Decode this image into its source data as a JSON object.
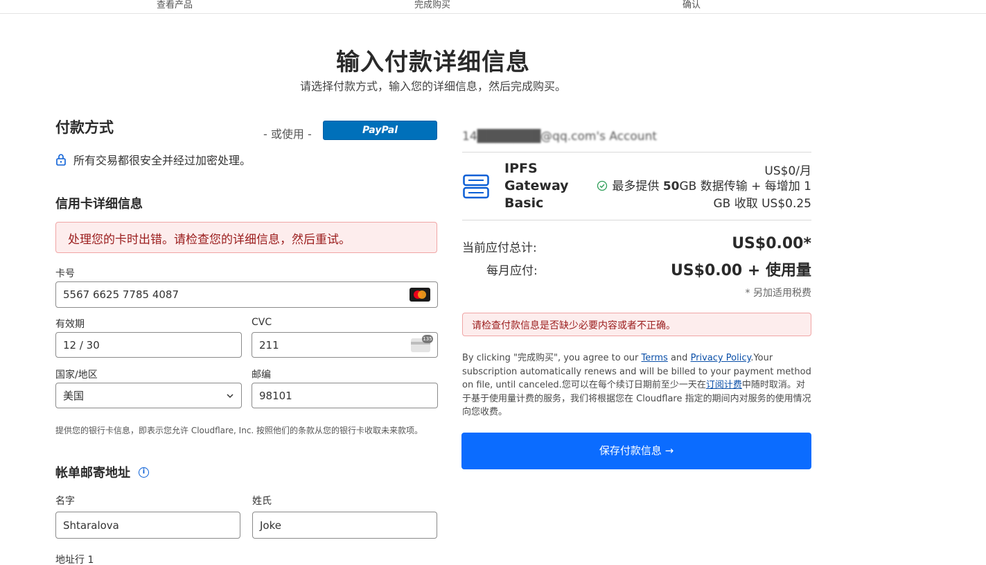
{
  "steps": [
    "查看产品",
    "完成购买",
    "确认"
  ],
  "page": {
    "title": "输入付款详细信息",
    "subtitle": "请选择付款方式，输入您的详细信息，然后完成购买。"
  },
  "payment": {
    "title": "付款方式",
    "or_use": "- 或使用 -",
    "paypal": "PayPal",
    "secure_note": "所有交易都很安全并经过加密处理。"
  },
  "card": {
    "title": "信用卡详细信息",
    "error": "处理您的卡时出错。请检查您的详细信息，然后重试。",
    "number_label": "卡号",
    "number_value": "5567 6625 7785 4087",
    "expiry_label": "有效期",
    "expiry_value": "12 / 30",
    "cvc_label": "CVC",
    "cvc_value": "211",
    "cvc_badge": "135",
    "country_label": "国家/地区",
    "country_value": "美国",
    "zip_label": "邮编",
    "zip_value": "98101",
    "consent": "提供您的银行卡信息，即表示您允许 Cloudflare, Inc. 按照他们的条款从您的银行卡收取未来款项。"
  },
  "billing": {
    "title": "帐单邮寄地址",
    "info_icon": "i",
    "first_name_label": "名字",
    "first_name_value": "Shtaralova",
    "last_name_label": "姓氏",
    "last_name_value": "Joke",
    "address1_label": "地址行 1"
  },
  "summary": {
    "email": "14███████@qq.com's Account",
    "product": {
      "name": "IPFS Gateway Basic",
      "price": "US$0/月",
      "feature_pre": "最多提供 ",
      "feature_bold": "50",
      "feature_post": "GB 数据传输 + 每增加 1 GB 收取 US$0.25"
    },
    "current_total_label": "当前应付总计:",
    "current_total_value": "US$0.00*",
    "monthly_label": "每月应付:",
    "monthly_value": "US$0.00 + 使用量",
    "tax_note": "* 另加适用税费",
    "warning": "请检查付款信息是否缺少必要内容或者不正确。",
    "legal": {
      "part1": "By clicking \"完成购买\", you agree to our ",
      "terms": "Terms",
      "and": " and ",
      "privacy": "Privacy Policy",
      "part2": ".Your subscription automatically renews and will be billed to your payment method on file, until canceled.您可以在每个续订日期前至少一天在",
      "billing_link": "订阅计费",
      "part3": "中随时取消。对于基于使用量计费的服务，我们将根据您在 Cloudflare 指定的期间内对服务的使用情况向您收费。"
    },
    "submit": "保存付款信息 →"
  },
  "colors": {
    "primary_button": "#0b6cff",
    "paypal": "#0070ba",
    "error_bg": "#fdeded",
    "error_text": "#9a1c1c",
    "link": "#0a4fa8"
  }
}
